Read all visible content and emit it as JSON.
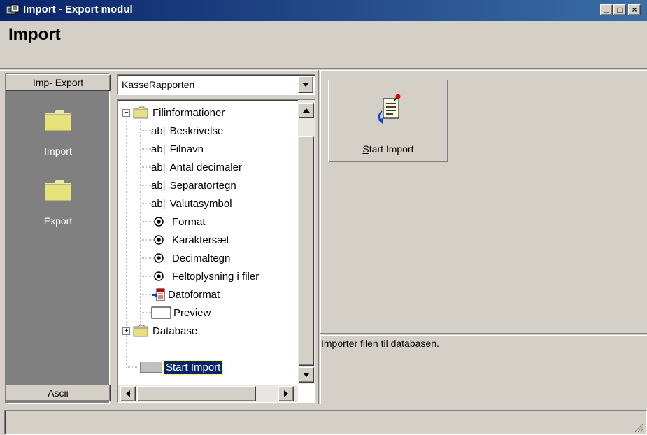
{
  "window": {
    "title": "Import - Export modul",
    "buttons": {
      "minimize": "_",
      "maximize": "□",
      "close": "×"
    }
  },
  "header": {
    "title": "Import"
  },
  "left_panel": {
    "top_button": "Imp- Export",
    "shortcuts": [
      {
        "label": "Import",
        "icon": "folder-icon"
      },
      {
        "label": "Export",
        "icon": "folder-icon"
      }
    ],
    "bottom_button": "Ascii"
  },
  "combo": {
    "value": "KasseRapporten"
  },
  "tree": {
    "items": [
      {
        "label": "Filinformationer",
        "icon": "folder-icon",
        "expander": "−"
      },
      {
        "label": "Beskrivelse",
        "icon": "ab|"
      },
      {
        "label": "Filnavn",
        "icon": "ab|"
      },
      {
        "label": "Antal decimaler",
        "icon": "ab|"
      },
      {
        "label": "Separatortegn",
        "icon": "ab|"
      },
      {
        "label": "Valutasymbol",
        "icon": "ab|"
      },
      {
        "label": "Format",
        "icon": "radio-icon"
      },
      {
        "label": "Karaktersæt",
        "icon": "radio-icon"
      },
      {
        "label": "Decimaltegn",
        "icon": "radio-icon"
      },
      {
        "label": "Feltoplysning i filer",
        "icon": "radio-icon"
      },
      {
        "label": "Datoformat",
        "icon": "date-format-icon"
      },
      {
        "label": "Preview",
        "icon": "preview-icon"
      },
      {
        "label": "Database",
        "icon": "folder-icon",
        "expander": "+"
      },
      {
        "label": "Start Import",
        "icon": "action-icon",
        "selected": true
      }
    ]
  },
  "action": {
    "start_import_label": "Start Import",
    "mnemonic": "S",
    "rest": "tart Import"
  },
  "description": {
    "text": "Importer filen til databasen."
  },
  "colors": {
    "titlebar_start": "#0a246a",
    "titlebar_end": "#3a6ea5",
    "selection": "#0a246a",
    "panel": "#808080",
    "face": "#d4d0c8"
  }
}
